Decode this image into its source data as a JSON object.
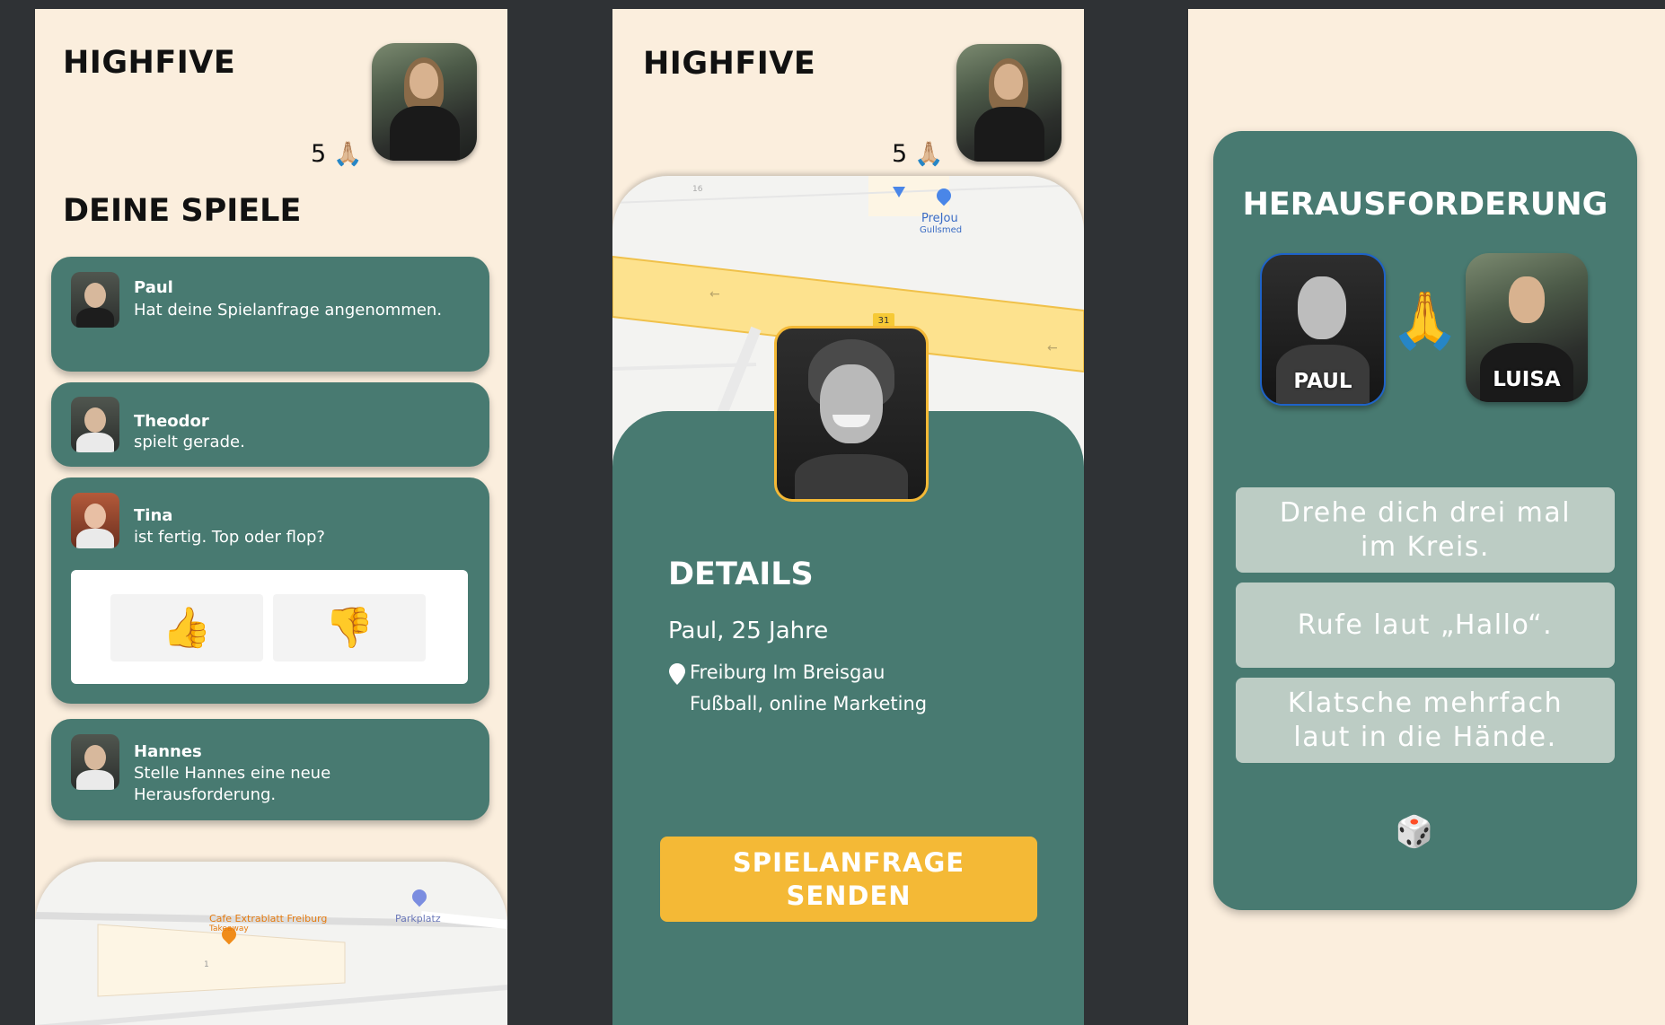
{
  "screen1": {
    "brand": "HIGHFIVE",
    "highfive_count": "5",
    "section_title": "DEINE SPIELE",
    "games": [
      {
        "name": "Paul",
        "text": "Hat deine Spielanfrage angenommen."
      },
      {
        "name": "Theodor",
        "text": "spielt gerade."
      },
      {
        "name": "Tina",
        "text": " ist fertig. Top oder flop?"
      },
      {
        "name": "Hannes",
        "text": "Stelle Hannes eine neue Herausforderung."
      }
    ],
    "vote": {
      "up": "👍",
      "down": "👎"
    },
    "map": {
      "poi1": "Cafe Extrablatt Freiburg",
      "poi1_sub": "Takeaway",
      "poi2": "Parkplatz",
      "num": "1"
    }
  },
  "screen2": {
    "brand": "HIGHFIVE",
    "highfive_count": "5",
    "map": {
      "poi": "PreJou",
      "poi_sub": "Gullsmed",
      "road_num": "31",
      "street_num": "16"
    },
    "details_title": "DETAILS",
    "name_age": "Paul, 25 Jahre",
    "location": "Freiburg Im Breisgau",
    "interests": "Fußball, online Marketing",
    "cta_line1": "SPIELANFRAGE",
    "cta_line2": "SENDEN"
  },
  "screen3": {
    "title": "HERAUSFORDERUNG",
    "player1": "PAUL",
    "player2": "LUISA",
    "tasks": [
      {
        "line1": "Drehe dich drei mal",
        "line2": "im Kreis."
      },
      {
        "line1": "Rufe laut „Hallo“.",
        "line2": ""
      },
      {
        "line1": "Klatsche mehrfach",
        "line2": "laut in die Hände."
      }
    ],
    "dice_icon": "dice-icon"
  },
  "colors": {
    "background": "#2f3235",
    "screen_bg": "#fbeedd",
    "card_green": "#487a71",
    "accent_yellow": "#f4b936",
    "task_bg": "#bcccc4"
  }
}
